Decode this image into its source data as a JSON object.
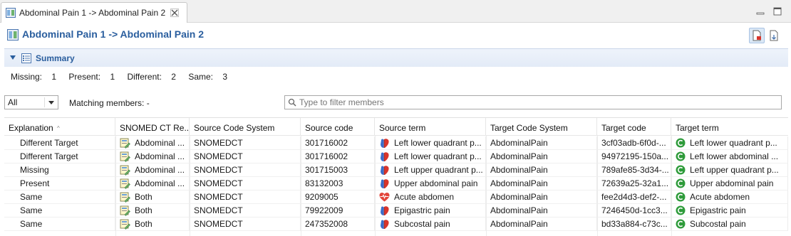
{
  "tab": {
    "title": "Abdominal Pain 1 -> Abdominal Pain 2"
  },
  "header": {
    "title": "Abdominal Pain 1 -> Abdominal Pain 2"
  },
  "summary": {
    "title": "Summary",
    "missing_label": "Missing:",
    "missing": "1",
    "present_label": "Present:",
    "present": "1",
    "different_label": "Different:",
    "different": "2",
    "same_label": "Same:",
    "same": "3"
  },
  "filter": {
    "select_value": "All",
    "matching_label": "Matching members: -",
    "search_placeholder": "Type to filter members"
  },
  "table": {
    "columns": [
      "Explanation",
      "SNOMED CT Re...",
      "Source Code System",
      "Source code",
      "Source term",
      "Target Code System",
      "Target code",
      "Target term"
    ],
    "rows": [
      [
        "Different Target",
        "Abdominal ...",
        "SNOMEDCT",
        "301716002",
        "Left lower quadrant p...",
        "AbdominalPain",
        "3cf03adb-6f0d-...",
        "Left lower quadrant p..."
      ],
      [
        "Different Target",
        "Abdominal ...",
        "SNOMEDCT",
        "301716002",
        "Left lower quadrant p...",
        "AbdominalPain",
        "94972195-150a...",
        "Left lower abdominal ..."
      ],
      [
        "Missing",
        "Abdominal ...",
        "SNOMEDCT",
        "301715003",
        "Left upper quadrant p...",
        "AbdominalPain",
        "789afe85-3d34-...",
        "Left upper quadrant p..."
      ],
      [
        "Present",
        "Abdominal ...",
        "SNOMEDCT",
        "83132003",
        "Upper abdominal pain",
        "AbdominalPain",
        "72639a25-32a1...",
        "Upper abdominal pain"
      ],
      [
        "Same",
        "Both",
        "SNOMEDCT",
        "9209005",
        "Acute abdomen",
        "AbdominalPain",
        "fee2d4d3-def2-...",
        "Acute abdomen"
      ],
      [
        "Same",
        "Both",
        "SNOMEDCT",
        "79922009",
        "Epigastric pain",
        "AbdominalPain",
        "7246450d-1cc3...",
        "Epigastric pain"
      ],
      [
        "Same",
        "Both",
        "SNOMEDCT",
        "247352008",
        "Subcostal pain",
        "AbdominalPain",
        "bd33a884-c73c...",
        "Subcostal pain"
      ]
    ],
    "source_term_icons": [
      "heart-icon",
      "heart-icon",
      "heart-icon",
      "heart-icon",
      "heart-pulse-icon",
      "heart-icon",
      "heart-icon"
    ]
  },
  "colors": {
    "accent": "#2a5e9e",
    "concept_green": "#2e9b3a",
    "heart_red": "#d9342b"
  }
}
